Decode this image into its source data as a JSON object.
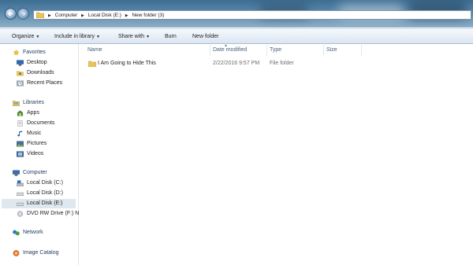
{
  "breadcrumb": [
    "Computer",
    "Local Disk (E:)",
    "New folder (3)"
  ],
  "toolbar": {
    "organize": "Organize",
    "include_in_library": "Include in library",
    "share_with": "Share with",
    "burn": "Burn",
    "new_folder": "New folder"
  },
  "nav": {
    "favorites": {
      "label": "Favorites",
      "items": [
        "Desktop",
        "Downloads",
        "Recent Places"
      ]
    },
    "libraries": {
      "label": "Libraries",
      "items": [
        "Apps",
        "Documents",
        "Music",
        "Pictures",
        "Videos"
      ]
    },
    "computer": {
      "label": "Computer",
      "items": [
        "Local Disk (C:)",
        "Local Disk (D:)",
        "Local Disk (E:)",
        "DVD RW Drive (F:) N"
      ],
      "selected": "Local Disk (E:)"
    },
    "network": "Network",
    "image_catalog": "Image Catalog"
  },
  "columns": {
    "name": "Name",
    "date_modified": "Date modified",
    "type": "Type",
    "size": "Size"
  },
  "files": [
    {
      "name": "I Am Going to Hide This",
      "date_modified": "2/22/2016 9:57 PM",
      "type": "File folder",
      "size": ""
    }
  ],
  "colors": {
    "titlebar": "#5a87aa",
    "commandbar": "#e6eef6",
    "selection": "#dfe7ef",
    "header_text": "#4c607a"
  }
}
